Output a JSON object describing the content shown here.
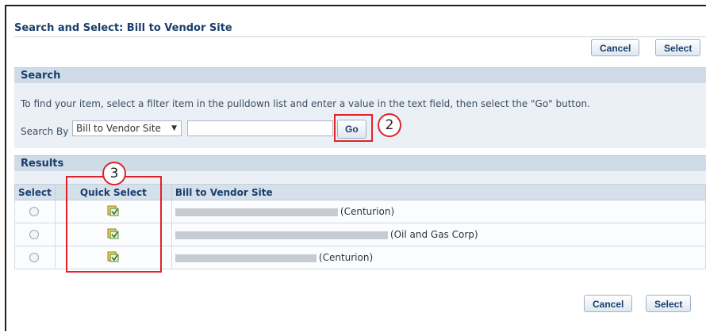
{
  "title": "Search and Select: Bill to Vendor Site",
  "buttons": {
    "cancel": "Cancel",
    "select": "Select"
  },
  "search": {
    "header": "Search",
    "instructions": "To find your item, select a filter item in the pulldown list and enter a value in the text field, then select the \"Go\" button.",
    "search_by_label": "Search By",
    "search_by_value": "Bill to Vendor Site",
    "text_value": "",
    "go_label": "Go"
  },
  "callouts": {
    "go": "2",
    "quick_select": "3"
  },
  "results": {
    "header": "Results",
    "columns": [
      "Select",
      "Quick Select",
      "Bill to Vendor Site"
    ],
    "rows": [
      {
        "site_suffix": "(Centurion)"
      },
      {
        "site_suffix": "(Oil and Gas Corp)"
      },
      {
        "site_suffix": "(Centurion)"
      }
    ]
  },
  "icons": {
    "quick_select": "quick-select-icon",
    "dropdown": "chevron-down-icon"
  },
  "colors": {
    "accent": "#1a3e6c",
    "callout": "#e0232b",
    "panel": "#eaf0f6",
    "header": "#cfdbe7"
  }
}
